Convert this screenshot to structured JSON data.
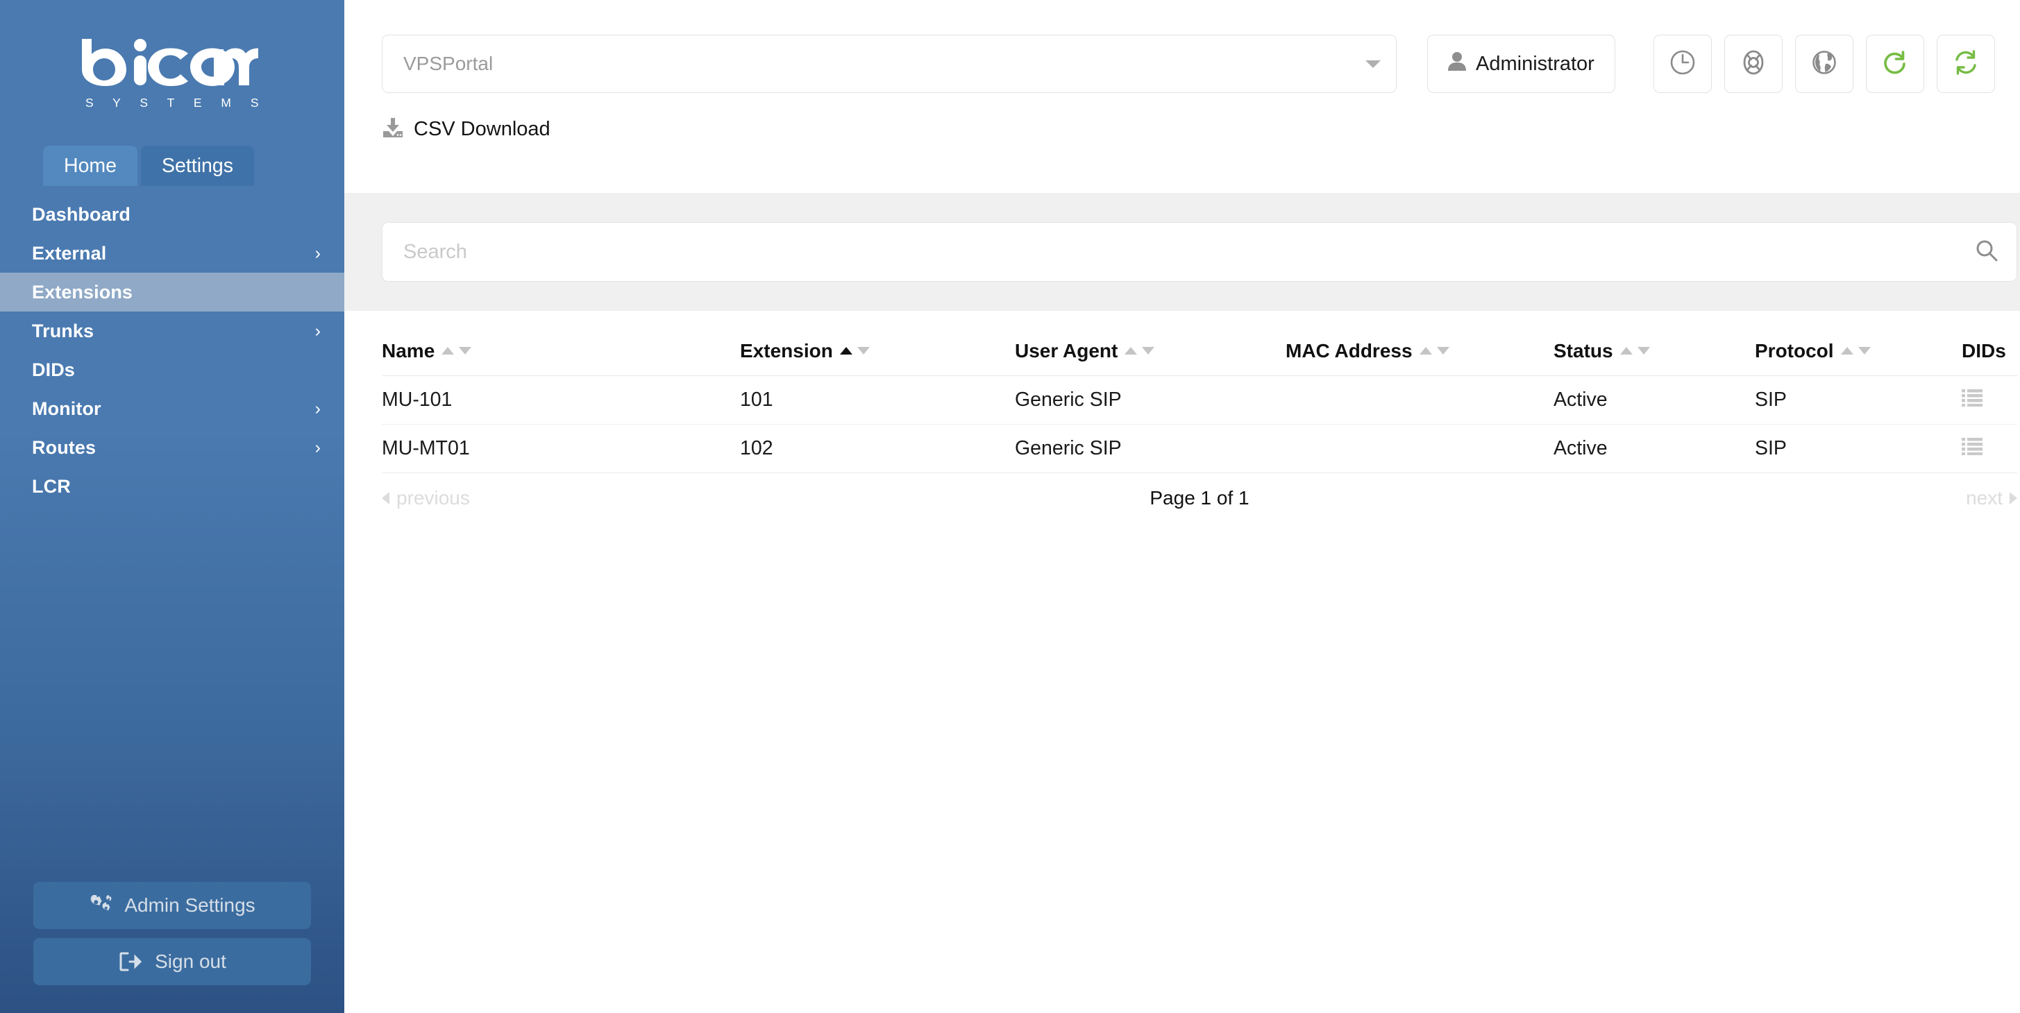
{
  "brand": {
    "name": "bicom",
    "subtitle": "S Y S T E M S",
    "logo_color": "#ffffff",
    "sidebar_color": "#4a7ab0"
  },
  "sidebar": {
    "tabs": [
      {
        "label": "Home",
        "active": true
      },
      {
        "label": "Settings",
        "active": false
      }
    ],
    "items": [
      {
        "label": "Dashboard",
        "chevron": false,
        "active": false
      },
      {
        "label": "External",
        "chevron": true,
        "active": false
      },
      {
        "label": "Extensions",
        "chevron": false,
        "active": true
      },
      {
        "label": "Trunks",
        "chevron": true,
        "active": false
      },
      {
        "label": "DIDs",
        "chevron": false,
        "active": false
      },
      {
        "label": "Monitor",
        "chevron": true,
        "active": false
      },
      {
        "label": "Routes",
        "chevron": true,
        "active": false
      },
      {
        "label": "LCR",
        "chevron": false,
        "active": false
      }
    ],
    "chevron_glyph": "›",
    "bottom_buttons": [
      {
        "label": "Admin Settings",
        "icon": "gears-icon"
      },
      {
        "label": "Sign out",
        "icon": "sign-out-icon"
      }
    ]
  },
  "topbar": {
    "server_select": {
      "value": "VPSPortal",
      "placeholder": "VPSPortal",
      "icon": "chevron-down-icon"
    },
    "user_button": {
      "label": "Administrator",
      "icon": "user-icon"
    },
    "icon_buttons": [
      {
        "name": "clock-icon",
        "color": "#8a8a8a"
      },
      {
        "name": "life-ring-icon",
        "color": "#8a8a8a"
      },
      {
        "name": "globe-icon",
        "color": "#8a8a8a"
      },
      {
        "name": "refresh-icon",
        "color": "#76bc43"
      },
      {
        "name": "sync-icon",
        "color": "#76bc43"
      }
    ]
  },
  "actions": {
    "csv_download": {
      "label": "CSV Download",
      "icon": "download-icon"
    }
  },
  "search": {
    "value": "",
    "placeholder": "Search",
    "icon": "search-icon"
  },
  "table": {
    "columns": [
      {
        "label": "Name",
        "sortable": true,
        "sort": "none"
      },
      {
        "label": "Extension",
        "sortable": true,
        "sort": "asc"
      },
      {
        "label": "User Agent",
        "sortable": true,
        "sort": "none"
      },
      {
        "label": "MAC Address",
        "sortable": true,
        "sort": "none"
      },
      {
        "label": "Status",
        "sortable": true,
        "sort": "none"
      },
      {
        "label": "Protocol",
        "sortable": true,
        "sort": "none"
      },
      {
        "label": "DIDs",
        "sortable": false,
        "sort": "none"
      }
    ],
    "rows": [
      {
        "name": "MU-101",
        "extension": "101",
        "user_agent": "Generic SIP",
        "mac_address": "",
        "status": "Active",
        "protocol": "SIP",
        "dids_icon": "list-icon"
      },
      {
        "name": "MU-MT01",
        "extension": "102",
        "user_agent": "Generic SIP",
        "mac_address": "",
        "status": "Active",
        "protocol": "SIP",
        "dids_icon": "list-icon"
      }
    ]
  },
  "pagination": {
    "previous_label": "previous",
    "next_label": "next",
    "page_info": "Page 1 of 1",
    "current_page": 1,
    "total_pages": 1
  }
}
